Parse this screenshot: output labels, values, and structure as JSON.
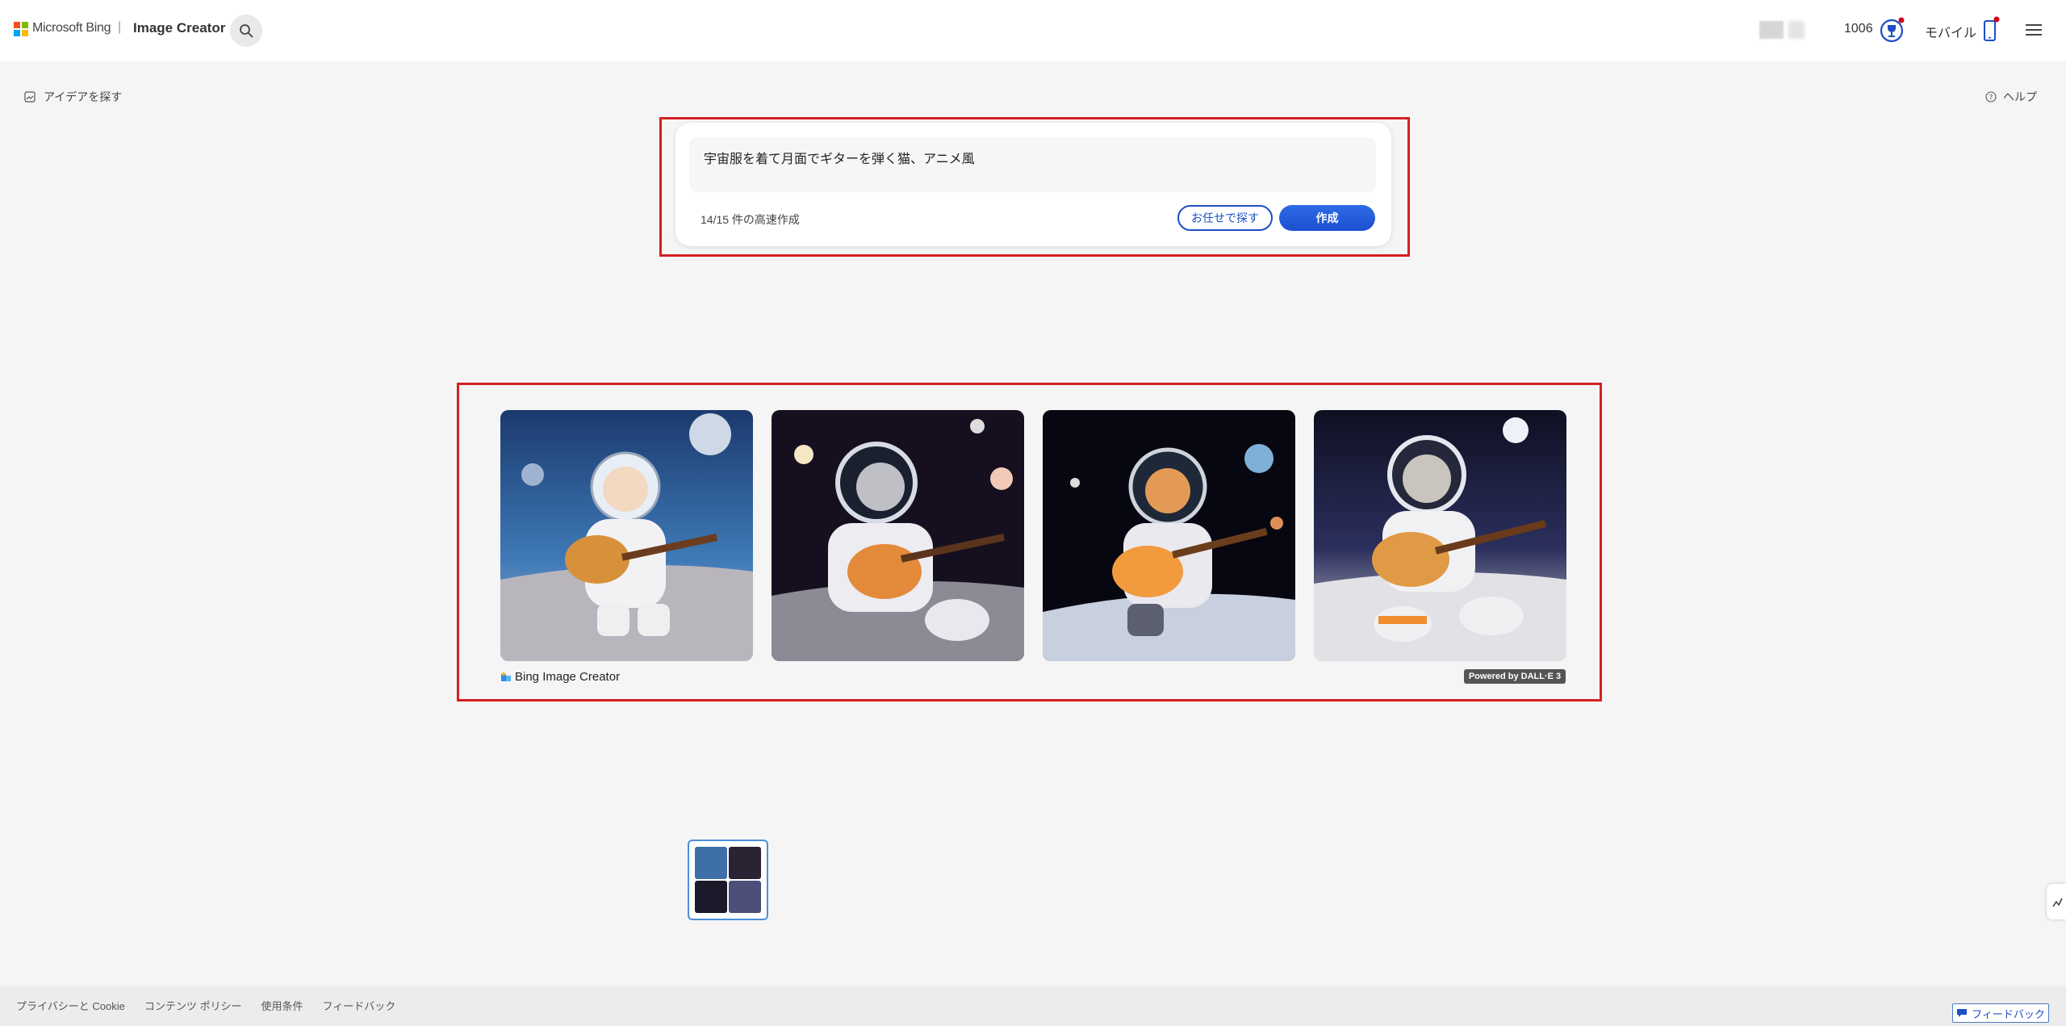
{
  "header": {
    "brand": "Microsoft Bing",
    "separator": "|",
    "product": "Image Creator",
    "points": "1006",
    "mobile_label": "モバイル"
  },
  "toolbar": {
    "ideas_label": "アイデアを探す",
    "help_label": "ヘルプ"
  },
  "prompt": {
    "text": "宇宙服を着て月面でギターを弾く猫、アニメ風",
    "boost_status": "14/15 件の高速作成",
    "surprise_label": "お任せで探す",
    "create_label": "作成"
  },
  "results": {
    "images": [
      {
        "alt": "astronaut cat playing guitar on moon 1"
      },
      {
        "alt": "astronaut cat playing guitar on moon 2"
      },
      {
        "alt": "astronaut cat playing guitar on moon 3"
      },
      {
        "alt": "astronaut cat playing guitar on moon 4"
      }
    ],
    "watermark": "Bing Image Creator",
    "badge": "Powered by DALL·E 3"
  },
  "footer": {
    "links": [
      "プライバシーと Cookie",
      "コンテンツ ポリシー",
      "使用条件",
      "フィードバック"
    ],
    "feedback_button": "フィードバック"
  },
  "colors": {
    "accent": "#1d4ec6",
    "highlight_box": "#d42020"
  }
}
